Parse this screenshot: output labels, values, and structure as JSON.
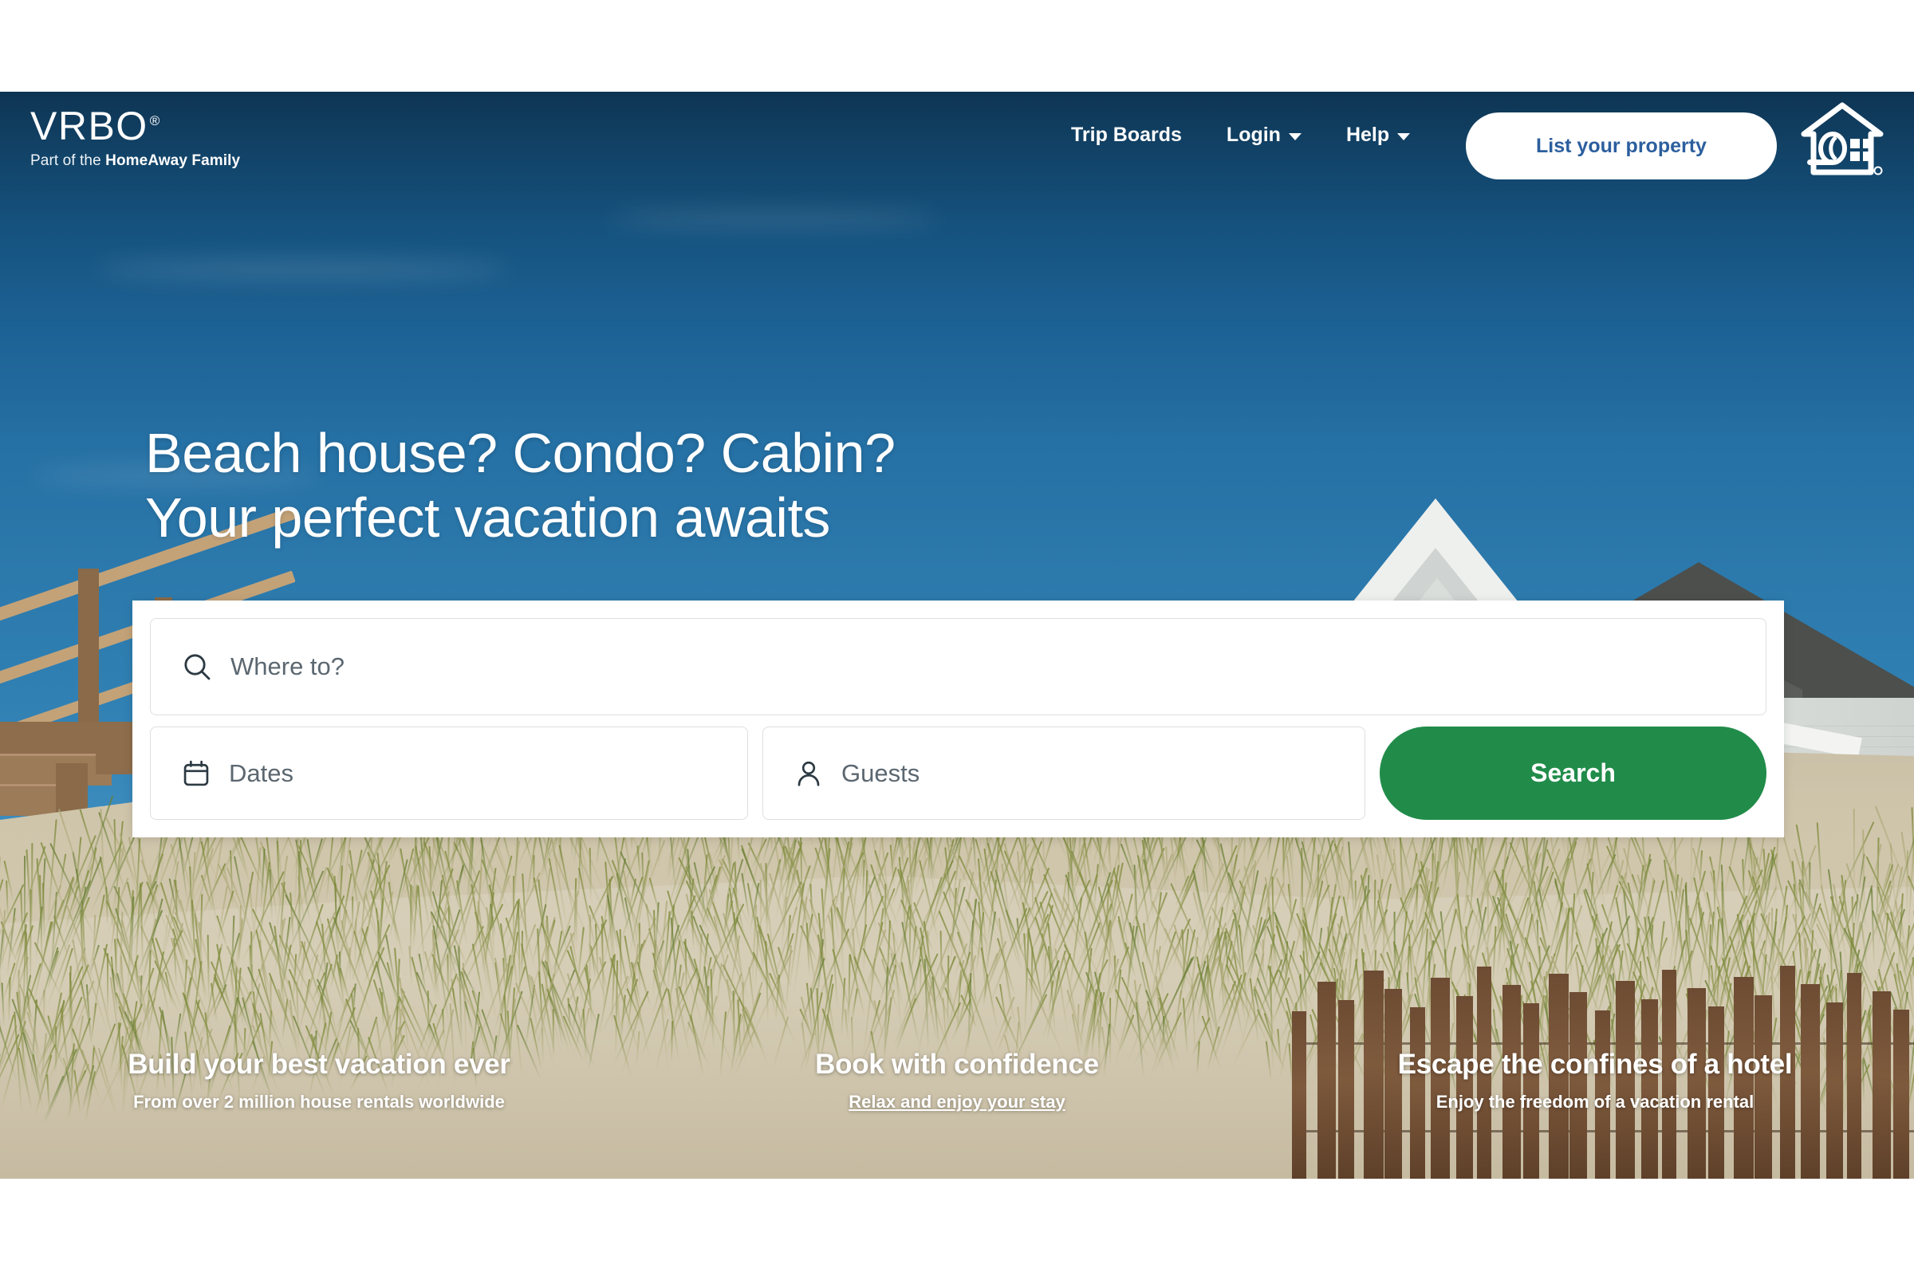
{
  "brand": {
    "name": "VRBO",
    "registered": "®",
    "tagline_prefix": "Part of the ",
    "tagline_brand": "HomeAway Family",
    "accent_blue": "#2c5f9e",
    "accent_green": "#218c4a",
    "header_navy": "#0e3453"
  },
  "header": {
    "nav": [
      {
        "label": "Trip Boards",
        "has_caret": false
      },
      {
        "label": "Login",
        "has_caret": true
      },
      {
        "label": "Help",
        "has_caret": true
      }
    ],
    "cta_label": "List your property",
    "house_icon": "homeaway-house-icon"
  },
  "hero": {
    "headline_line1": "Beach house? Condo? Cabin?",
    "headline_line2": "Your perfect vacation awaits"
  },
  "search": {
    "where_placeholder": "Where to?",
    "where_icon": "search-icon",
    "dates_placeholder": "Dates",
    "dates_icon": "calendar-icon",
    "guests_placeholder": "Guests",
    "guests_icon": "person-icon",
    "search_button": "Search"
  },
  "value_props": [
    {
      "title": "Build your best vacation ever",
      "subtitle": "From over 2 million house rentals worldwide",
      "is_link": false
    },
    {
      "title": "Book with confidence",
      "subtitle": "Relax and enjoy your stay",
      "is_link": true
    },
    {
      "title": "Escape the confines of a hotel",
      "subtitle": "Enjoy the freedom of a vacation rental",
      "is_link": false
    }
  ]
}
